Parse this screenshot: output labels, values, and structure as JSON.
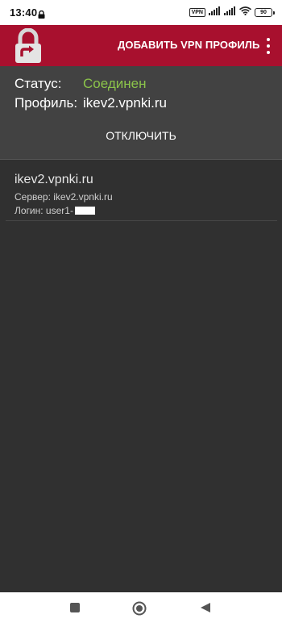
{
  "status_bar": {
    "time": "13:40",
    "vpn_badge": "VPN",
    "battery": "90"
  },
  "app_bar": {
    "logo_icon": "lock-arrow-logo",
    "add_vpn_label": "ДОБАВИТЬ VPN ПРОФИЛЬ",
    "overflow_icon": "more-vert-icon",
    "color": "#a8102e"
  },
  "status_panel": {
    "status_label": "Статус:",
    "status_value": "Соединен",
    "status_value_color": "#8bc34a",
    "profile_label": "Профиль:",
    "profile_value": "ikev2.vpnki.ru",
    "disconnect_label": "ОТКЛЮЧИТЬ"
  },
  "profiles": [
    {
      "name": "ikev2.vpnki.ru",
      "server": "Сервер: ikev2.vpnki.ru",
      "login": "Логин: user1-"
    }
  ],
  "nav_bar": {
    "recents_icon": "square-icon",
    "home_icon": "circle-icon",
    "back_icon": "triangle-back-icon"
  }
}
